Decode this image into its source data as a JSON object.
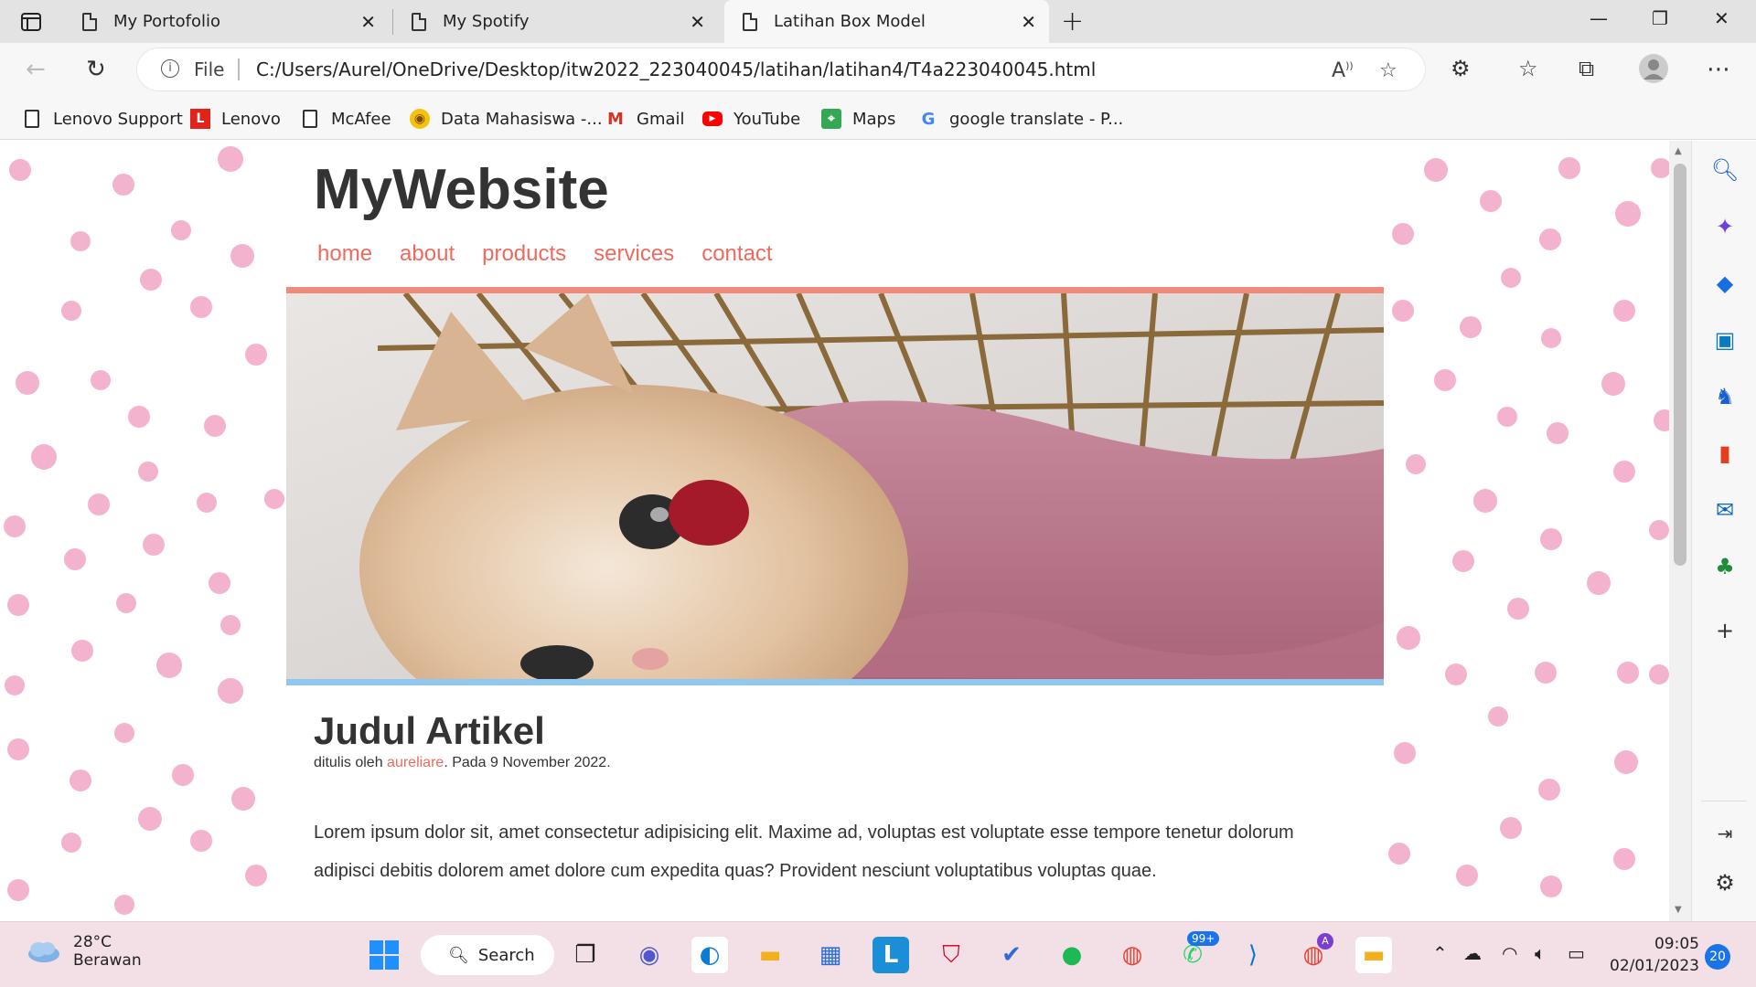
{
  "browser": {
    "tabs": [
      {
        "label": "My Portofolio"
      },
      {
        "label": "My Spotify"
      },
      {
        "label": "Latihan Box Model"
      }
    ],
    "address": {
      "scheme_label": "File",
      "url": "C:/Users/Aurel/OneDrive/Desktop/itw2022_223040045/latihan/latihan4/T4a223040045.html"
    },
    "bookmarks": [
      {
        "label": "Lenovo Support"
      },
      {
        "label": "Lenovo"
      },
      {
        "label": "McAfee"
      },
      {
        "label": "Data Mahasiswa -..."
      },
      {
        "label": "Gmail"
      },
      {
        "label": "YouTube"
      },
      {
        "label": "Maps"
      },
      {
        "label": "google translate - P..."
      }
    ]
  },
  "page": {
    "site_title": "MyWebsite",
    "nav": [
      "home",
      "about",
      "products",
      "services",
      "contact"
    ],
    "article": {
      "title": "Judul Artikel",
      "byline_prefix": "ditulis oleh ",
      "author": "aureliare",
      "byline_suffix": ". Pada 9 November 2022.",
      "body": "Lorem ipsum dolor sit, amet consectetur adipisicing elit. Maxime ad, voluptas est voluptate esse tempore tenetur dolorum adipisci debitis dolorem amet dolore cum expedita quas? Provident nesciunt voluptatibus voluptas quae."
    },
    "colors": {
      "accent": "#ee6a5f",
      "hero_top_border": "#f08a7c",
      "hero_bottom_border": "#8fc7ee",
      "dots": "#f2a5c6"
    }
  },
  "taskbar": {
    "weather": {
      "temp": "28°C",
      "condition": "Berawan"
    },
    "search_label": "Search",
    "whatsapp_badge": "99+",
    "chrome_badge": "A",
    "clock": {
      "time": "09:05",
      "date": "02/01/2023"
    },
    "notification_count": "20"
  }
}
